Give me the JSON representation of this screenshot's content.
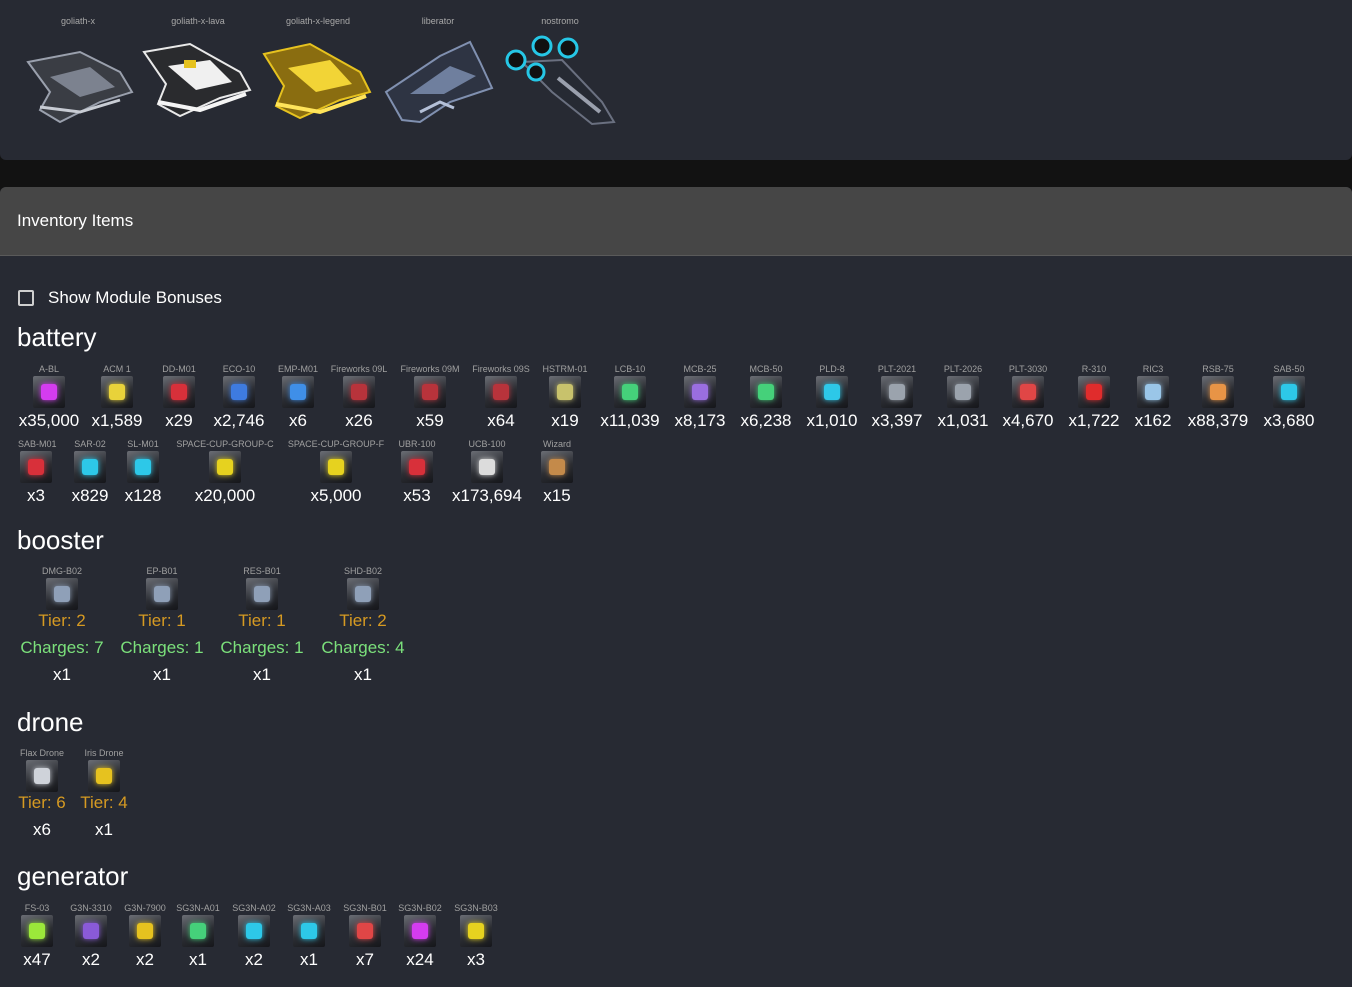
{
  "ships": [
    {
      "name": "goliath-x",
      "color": "#9aa0ad"
    },
    {
      "name": "goliath-x-lava",
      "color": "#e9e9e9"
    },
    {
      "name": "goliath-x-legend",
      "color": "#e6c21f"
    },
    {
      "name": "liberator",
      "color": "#6f7f9e"
    },
    {
      "name": "nostromo",
      "color": "#26c7e6"
    }
  ],
  "inventory": {
    "title": "Inventory Items",
    "show_bonuses_label": "Show Module Bonuses",
    "categories": {
      "battery": {
        "title": "battery",
        "items": [
          {
            "name": "A-BL",
            "qty": "x35,000",
            "color": "#d43cf0"
          },
          {
            "name": "ACM 1",
            "qty": "x1,589",
            "color": "#e8d23a"
          },
          {
            "name": "DD-M01",
            "qty": "x29",
            "color": "#d8303a"
          },
          {
            "name": "ECO-10",
            "qty": "x2,746",
            "color": "#3e7be0"
          },
          {
            "name": "EMP-M01",
            "qty": "x6",
            "color": "#3f8fe8"
          },
          {
            "name": "Fireworks 09L",
            "qty": "x26",
            "color": "#b8333b"
          },
          {
            "name": "Fireworks 09M",
            "qty": "x59",
            "color": "#b8333b"
          },
          {
            "name": "Fireworks 09S",
            "qty": "x64",
            "color": "#b8333b"
          },
          {
            "name": "HSTRM-01",
            "qty": "x19",
            "color": "#c8c26c"
          },
          {
            "name": "LCB-10",
            "qty": "x11,039",
            "color": "#45d17a"
          },
          {
            "name": "MCB-25",
            "qty": "x8,173",
            "color": "#9a6ee0"
          },
          {
            "name": "MCB-50",
            "qty": "x6,238",
            "color": "#45d17a"
          },
          {
            "name": "PLD-8",
            "qty": "x1,010",
            "color": "#2dc8e8"
          },
          {
            "name": "PLT-2021",
            "qty": "x3,397",
            "color": "#9ba3ad"
          },
          {
            "name": "PLT-2026",
            "qty": "x1,031",
            "color": "#9ba3ad"
          },
          {
            "name": "PLT-3030",
            "qty": "x4,670",
            "color": "#e04646"
          },
          {
            "name": "R-310",
            "qty": "x1,722",
            "color": "#e02c2c"
          },
          {
            "name": "RIC3",
            "qty": "x162",
            "color": "#9ac6e8"
          },
          {
            "name": "RSB-75",
            "qty": "x88,379",
            "color": "#e89446"
          },
          {
            "name": "SAB-50",
            "qty": "x3,680",
            "color": "#2dc8e8"
          },
          {
            "name": "SAB-M01",
            "qty": "x3",
            "color": "#d8303a"
          },
          {
            "name": "SAR-02",
            "qty": "x829",
            "color": "#2dc8e8"
          },
          {
            "name": "SL-M01",
            "qty": "x128",
            "color": "#2dc8e8"
          },
          {
            "name": "SPACE-CUP-GROUP-C",
            "qty": "x20,000",
            "color": "#e6d21f"
          },
          {
            "name": "SPACE-CUP-GROUP-F",
            "qty": "x5,000",
            "color": "#e6d21f"
          },
          {
            "name": "UBR-100",
            "qty": "x53",
            "color": "#d8303a"
          },
          {
            "name": "UCB-100",
            "qty": "x173,694",
            "color": "#dcdcdc"
          },
          {
            "name": "Wizard",
            "qty": "x15",
            "color": "#c48a4a"
          }
        ]
      },
      "booster": {
        "title": "booster",
        "items": [
          {
            "name": "DMG-B02",
            "tier": "Tier: 2",
            "charges": "Charges: 7",
            "qty": "x1"
          },
          {
            "name": "EP-B01",
            "tier": "Tier: 1",
            "charges": "Charges: 1",
            "qty": "x1"
          },
          {
            "name": "RES-B01",
            "tier": "Tier: 1",
            "charges": "Charges: 1",
            "qty": "x1"
          },
          {
            "name": "SHD-B02",
            "tier": "Tier: 2",
            "charges": "Charges: 4",
            "qty": "x1"
          }
        ]
      },
      "drone": {
        "title": "drone",
        "items": [
          {
            "name": "Flax Drone",
            "tier": "Tier: 6",
            "qty": "x6",
            "color": "#cfd3da"
          },
          {
            "name": "Iris Drone",
            "tier": "Tier: 4",
            "qty": "x1",
            "color": "#e6c21f"
          }
        ]
      },
      "generator": {
        "title": "generator",
        "items": [
          {
            "name": "FS-03",
            "qty": "x47",
            "color": "#9be83a"
          },
          {
            "name": "G3N-3310",
            "qty": "x2",
            "color": "#8a5ad8"
          },
          {
            "name": "G3N-7900",
            "qty": "x2",
            "color": "#e6c21f"
          },
          {
            "name": "SG3N-A01",
            "qty": "x1",
            "color": "#45d17a"
          },
          {
            "name": "SG3N-A02",
            "qty": "x2",
            "color": "#2dc8e8"
          },
          {
            "name": "SG3N-A03",
            "qty": "x1",
            "color": "#2dc8e8"
          },
          {
            "name": "SG3N-B01",
            "qty": "x7",
            "color": "#e04646"
          },
          {
            "name": "SG3N-B02",
            "qty": "x24",
            "color": "#d43cf0"
          },
          {
            "name": "SG3N-B03",
            "qty": "x3",
            "color": "#e6d21f"
          }
        ]
      }
    }
  }
}
